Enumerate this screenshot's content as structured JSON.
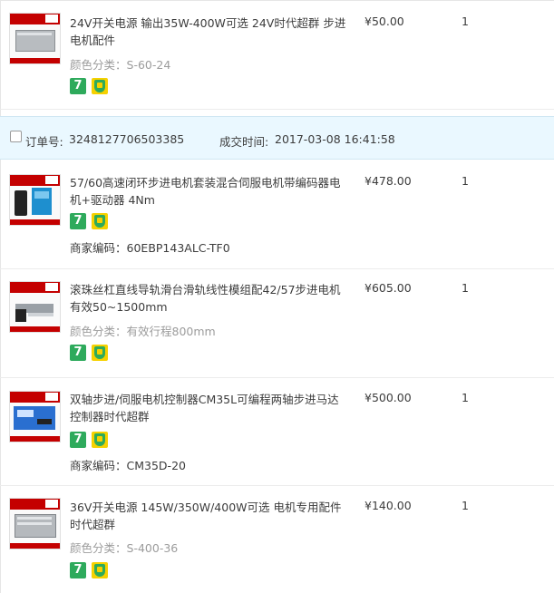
{
  "first_item": {
    "title": "24V开关电源 输出35W-400W可选 24V时代超群 步进电机配件",
    "attr_label": "颜色分类：",
    "attr_value": "S-60-24",
    "price": "¥50.00",
    "qty": "1",
    "badge_seven": "7"
  },
  "order": {
    "order_no_label": "订单号:",
    "order_no": "3248127706503385",
    "time_label": "成交时间:",
    "time": "2017-03-08 16:41:58"
  },
  "items": [
    {
      "title": "57/60高速闭环步进电机套装混合伺服电机带编码器电机+驱动器 4Nm",
      "attr_label": "商家编码：",
      "attr_value": "60EBP143ALC-TF0",
      "price": "¥478.00",
      "qty": "1",
      "badge_seven": "7"
    },
    {
      "title": "滚珠丝杠直线导轨滑台滑轨线性模组配42/57步进电机有效50~1500mm",
      "attr_label": "颜色分类：",
      "attr_value": "有效行程800mm",
      "price": "¥605.00",
      "qty": "1",
      "badge_seven": "7"
    },
    {
      "title": "双轴步进/伺服电机控制器CM35L可编程两轴步进马达控制器时代超群",
      "attr_label": "商家编码：",
      "attr_value": "CM35D-20",
      "price": "¥500.00",
      "qty": "1",
      "badge_seven": "7"
    },
    {
      "title": "36V开关电源 145W/350W/400W可选 电机专用配件时代超群",
      "attr_label": "颜色分类：",
      "attr_value": "S-400-36",
      "price": "¥140.00",
      "qty": "1",
      "badge_seven": "7"
    }
  ],
  "colors": {
    "order_bar_bg": "#eaf8ff",
    "badge_green": "#2eaa5c",
    "badge_yellow": "#f6d100",
    "thumb_red": "#c40000"
  },
  "icons": [
    "product-thumbnail",
    "seven-day-return-icon",
    "consumer-protection-icon",
    "checkbox"
  ]
}
